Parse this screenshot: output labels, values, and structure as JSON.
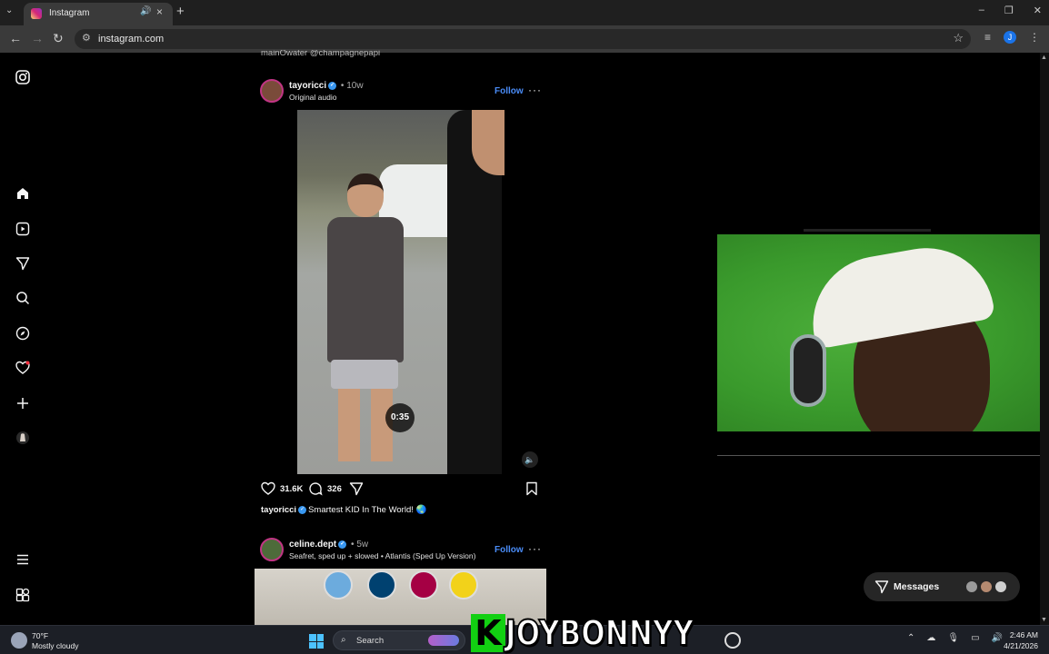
{
  "browser": {
    "tab_title": "Instagram",
    "url": "instagram.com",
    "profile_initial": "J"
  },
  "sidebar": {
    "items": [
      "instagram-logo",
      "home",
      "reels",
      "messages",
      "search",
      "explore",
      "notifications",
      "create",
      "profile",
      "more",
      "also-from-meta"
    ]
  },
  "feed": {
    "top_partial_text": "mainOwater @champagnepapi",
    "post1": {
      "username": "tayoricci",
      "time": "10w",
      "audio": "Original audio",
      "follow": "Follow",
      "video_time": "0:35",
      "likes": "31.6K",
      "comments": "326",
      "caption_user": "tayoricci",
      "caption_text": "Smartest KID In The World! 🌏"
    },
    "post2": {
      "username": "celine.dept",
      "time": "5w",
      "audio": "Seafret, sped up + slowed • Atlantis (Sped Up Version)",
      "follow": "Follow"
    }
  },
  "messages": {
    "label": "Messages"
  },
  "taskbar": {
    "temp": "70°F",
    "weather": "Mostly cloudy",
    "search_label": "Search",
    "time": "2:46 AM",
    "date": "4/21/2026"
  },
  "watermark": {
    "letter": "K",
    "text": "JOYBONNYY"
  }
}
